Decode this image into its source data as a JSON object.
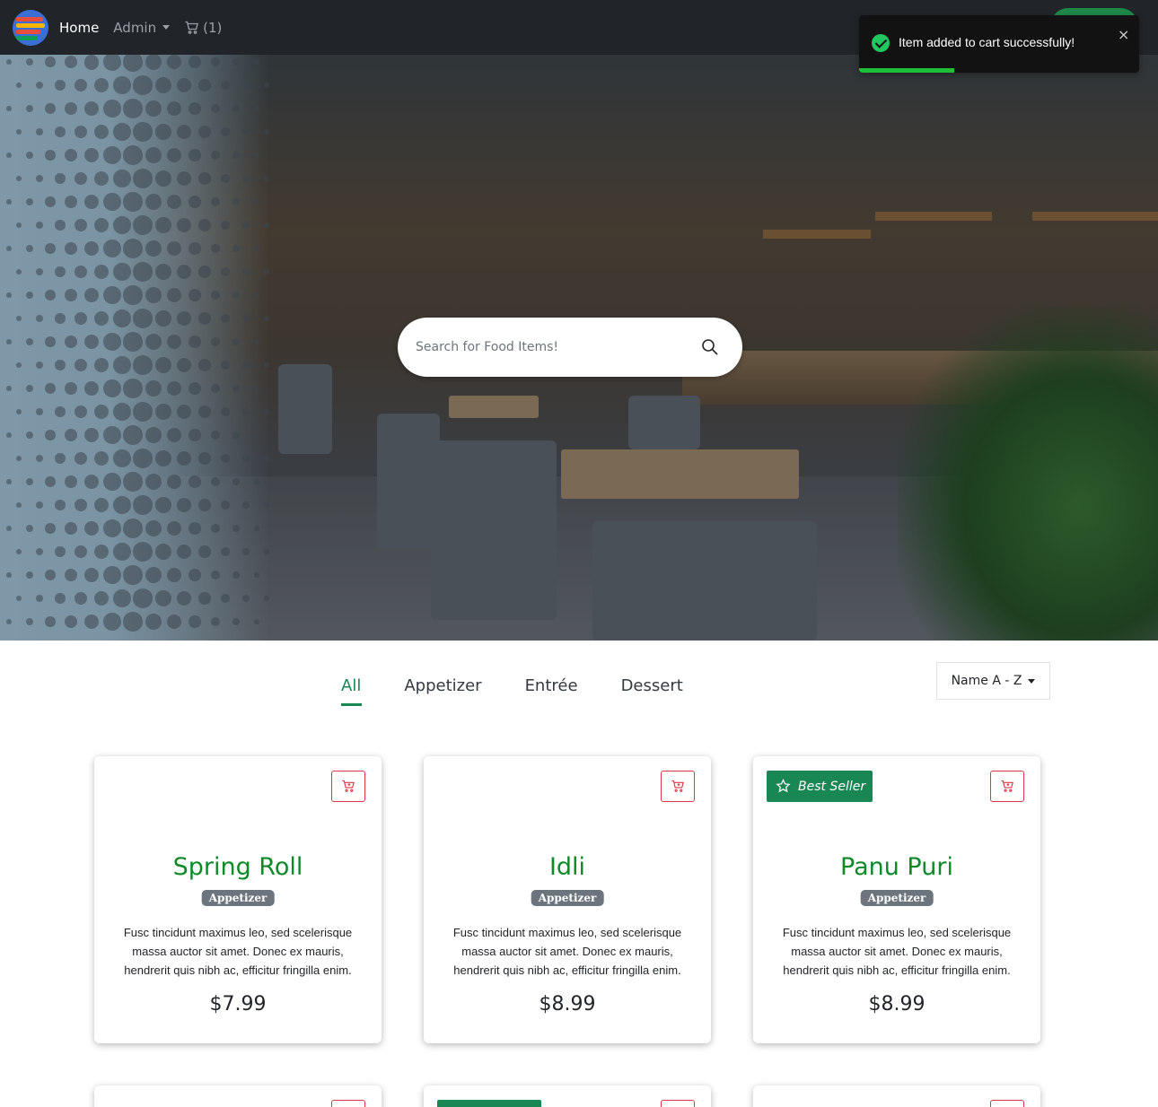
{
  "navbar": {
    "home": "Home",
    "admin": "Admin",
    "cart": "(1)"
  },
  "toast": {
    "message": "Item added to cart successfully!",
    "close": "×",
    "progress": 0.34
  },
  "search": {
    "placeholder": "Search for Food Items!"
  },
  "filters": {
    "tabs": [
      "All",
      "Appetizer",
      "Entrée",
      "Dessert"
    ],
    "active": "All"
  },
  "sort": {
    "label": "Name A - Z"
  },
  "products": [
    {
      "name": "Spring Roll",
      "category": "Appetizer",
      "description": "Fusc tincidunt maximus leo, sed scelerisque massa auctor sit amet. Donec ex mauris, hendrerit quis nibh ac, efficitur fringilla enim.",
      "price": "$7.99",
      "best_seller": false
    },
    {
      "name": "Idli",
      "category": "Appetizer",
      "description": "Fusc tincidunt maximus leo, sed scelerisque massa auctor sit amet. Donec ex mauris, hendrerit quis nibh ac, efficitur fringilla enim.",
      "price": "$8.99",
      "best_seller": false
    },
    {
      "name": "Panu Puri",
      "category": "Appetizer",
      "description": "Fusc tincidunt maximus leo, sed scelerisque massa auctor sit amet. Donec ex mauris, hendrerit quis nibh ac, efficitur fringilla enim.",
      "price": "$8.99",
      "best_seller": true,
      "best_seller_label": "Best Seller"
    }
  ],
  "icons": {
    "logo": "app-logo",
    "cart": "cart-icon",
    "search": "search-icon",
    "check": "check-circle-icon",
    "add_to_cart": "cart-plus-icon",
    "star": "star-outline-icon"
  },
  "colors": {
    "navbar": "#212529",
    "accent_green": "#198754",
    "title_green": "#108a28",
    "cart_red": "#dc3545",
    "badge_gray": "#6c757d",
    "toast_bg": "#121212",
    "toast_progress": "#1fbf3a"
  }
}
